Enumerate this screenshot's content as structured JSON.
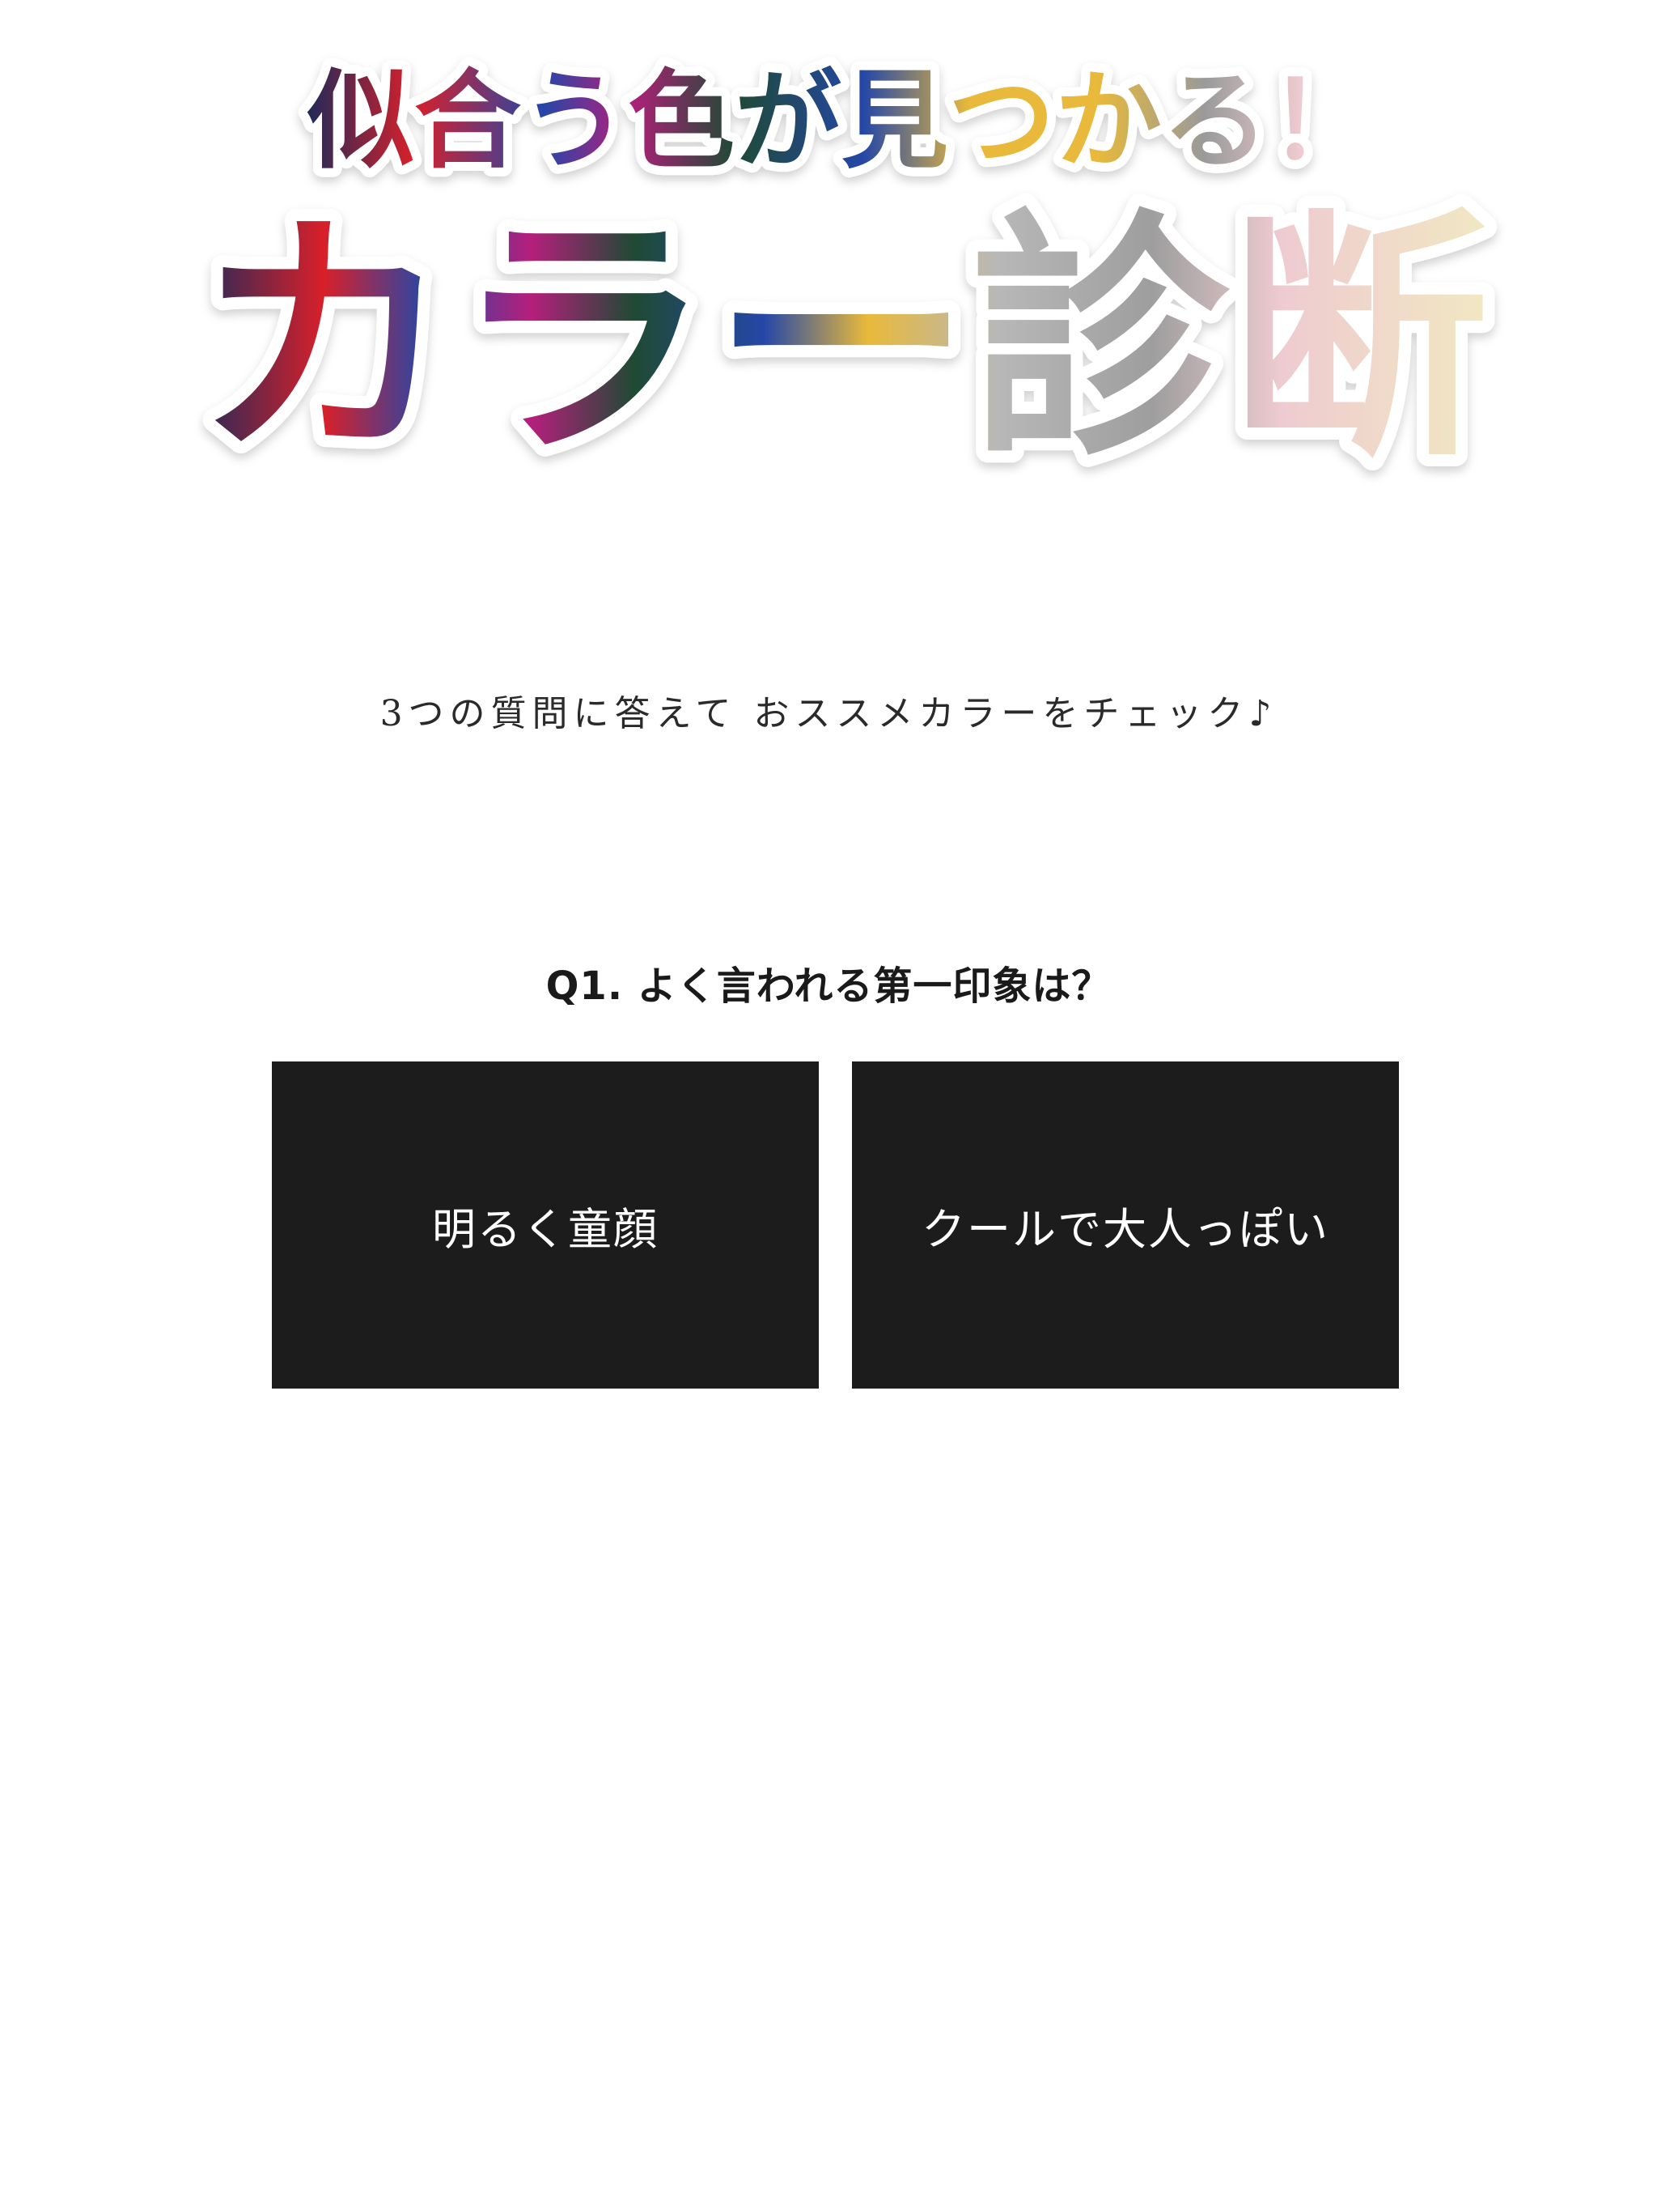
{
  "hero": {
    "tagline": "似合う色が見つかる！",
    "title": "カラー診断"
  },
  "subtitle": "3つの質問に答えて おススメカラーをチェック♪",
  "question": {
    "label": "Q1. よく言われる第一印象は？"
  },
  "answers": [
    {
      "label": "明るく童顔"
    },
    {
      "label": "クールで大人っぽい"
    }
  ],
  "colors": {
    "button_bg": "#1c1c1c",
    "button_text": "#ffffff",
    "text": "#1a1a1a",
    "title_navy": "#1e2a5a",
    "title_red": "#d8202a",
    "title_blue": "#2447a8",
    "title_green": "#1f4a34",
    "title_yellow": "#e8b93a",
    "title_gray": "#a8a8a8",
    "title_pink": "#eecbd0",
    "title_cream": "#f1e8c2"
  }
}
